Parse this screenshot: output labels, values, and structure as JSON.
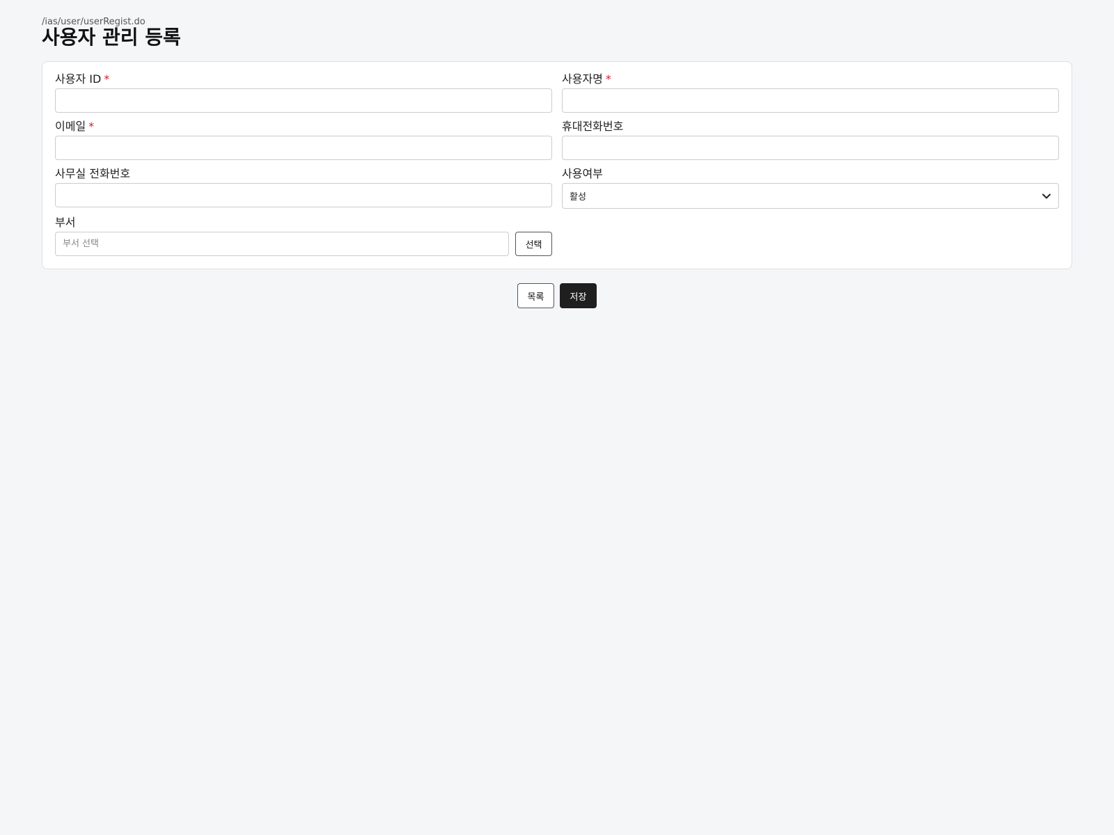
{
  "page": {
    "path": "/ias/user/userRegist.do",
    "title": "사용자 관리 등록"
  },
  "form": {
    "user_id": {
      "label": "사용자 ID",
      "required_mark": "*",
      "value": ""
    },
    "user_name": {
      "label": "사용자명",
      "required_mark": "*",
      "value": ""
    },
    "email": {
      "label": "이메일",
      "required_mark": "*",
      "value": ""
    },
    "mobile": {
      "label": "휴대전화번호",
      "value": ""
    },
    "office_phone": {
      "label": "사무실 전화번호",
      "value": ""
    },
    "use_yn": {
      "label": "사용여부",
      "selected": "활성"
    },
    "department": {
      "label": "부서",
      "placeholder": "부서 선택",
      "value": "",
      "select_label": "선택"
    }
  },
  "actions": {
    "list_label": "목록",
    "save_label": "저장"
  },
  "colors": {
    "required": "#d01f2f",
    "save_button": "#1f1f1f",
    "background": "#f5f6f8"
  }
}
